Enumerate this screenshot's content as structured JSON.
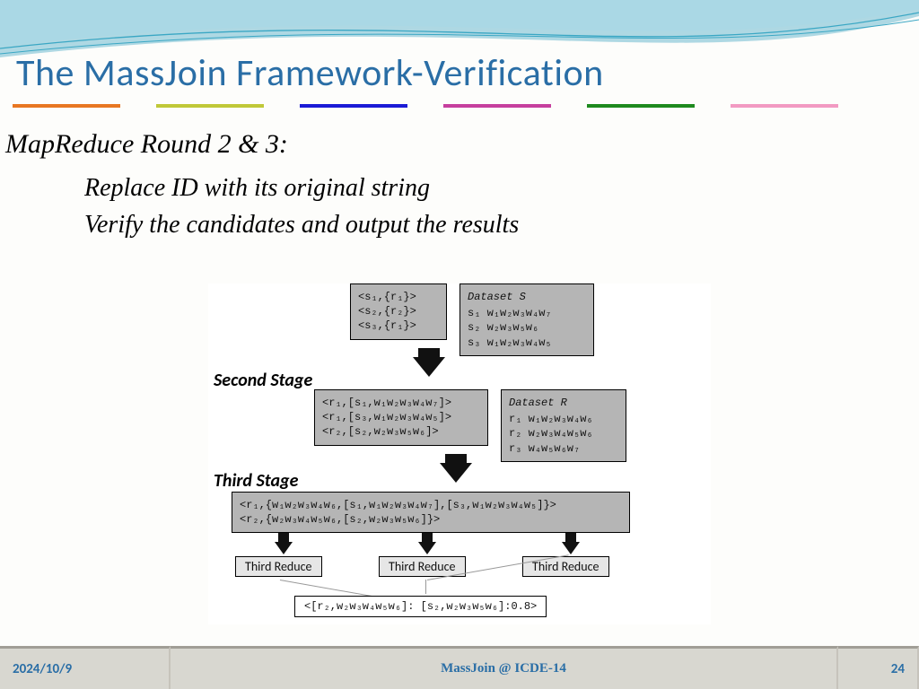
{
  "title": "The MassJoin Framework-Verification",
  "subtitle": "MapReduce Round 2 & 3:",
  "bullets": {
    "b1": "Replace ID with its original string",
    "b2": "Verify the candidates and output the results"
  },
  "labels": {
    "second": "Second Stage",
    "third": "Third Stage",
    "reduce": "Third Reduce"
  },
  "diagram": {
    "pairs": {
      "l1": "<s₁,{r₁}>",
      "l2": "<s₂,{r₂}>",
      "l3": "<s₃,{r₁}>"
    },
    "datasetS": {
      "title": "Dataset S",
      "r1": "s₁  w₁w₂w₃w₄w₇",
      "r2": "s₂  w₂w₃w₅w₆",
      "r3": "s₃  w₁w₂w₃w₄w₅"
    },
    "mid": {
      "l1": "<r₁,[s₁,w₁w₂w₃w₄w₇]>",
      "l2": "<r₁,[s₃,w₁w₂w₃w₄w₅]>",
      "l3": "<r₂,[s₂,w₂w₃w₅w₆]>"
    },
    "datasetR": {
      "title": "Dataset R",
      "r1": "r₁  w₁w₂w₃w₄w₆",
      "r2": "r₂  w₂w₃w₄w₅w₆",
      "r3": "r₃  w₄w₅w₆w₇"
    },
    "big": {
      "l1": "<r₁,{w₁w₂w₃w₄w₆,[s₁,w₁w₂w₃w₄w₇],[s₃,w₁w₂w₃w₄w₅]}>",
      "l2": "<r₂,{w₂w₃w₄w₅w₆,[s₂,w₂w₃w₅w₆]}>"
    },
    "result": "<[r₂,w₂w₃w₄w₅w₆]: [s₂,w₂w₃w₅w₆]:0.8>"
  },
  "footer": {
    "date": "2024/10/9",
    "center": "MassJoin @ ICDE-14",
    "page": "24"
  }
}
